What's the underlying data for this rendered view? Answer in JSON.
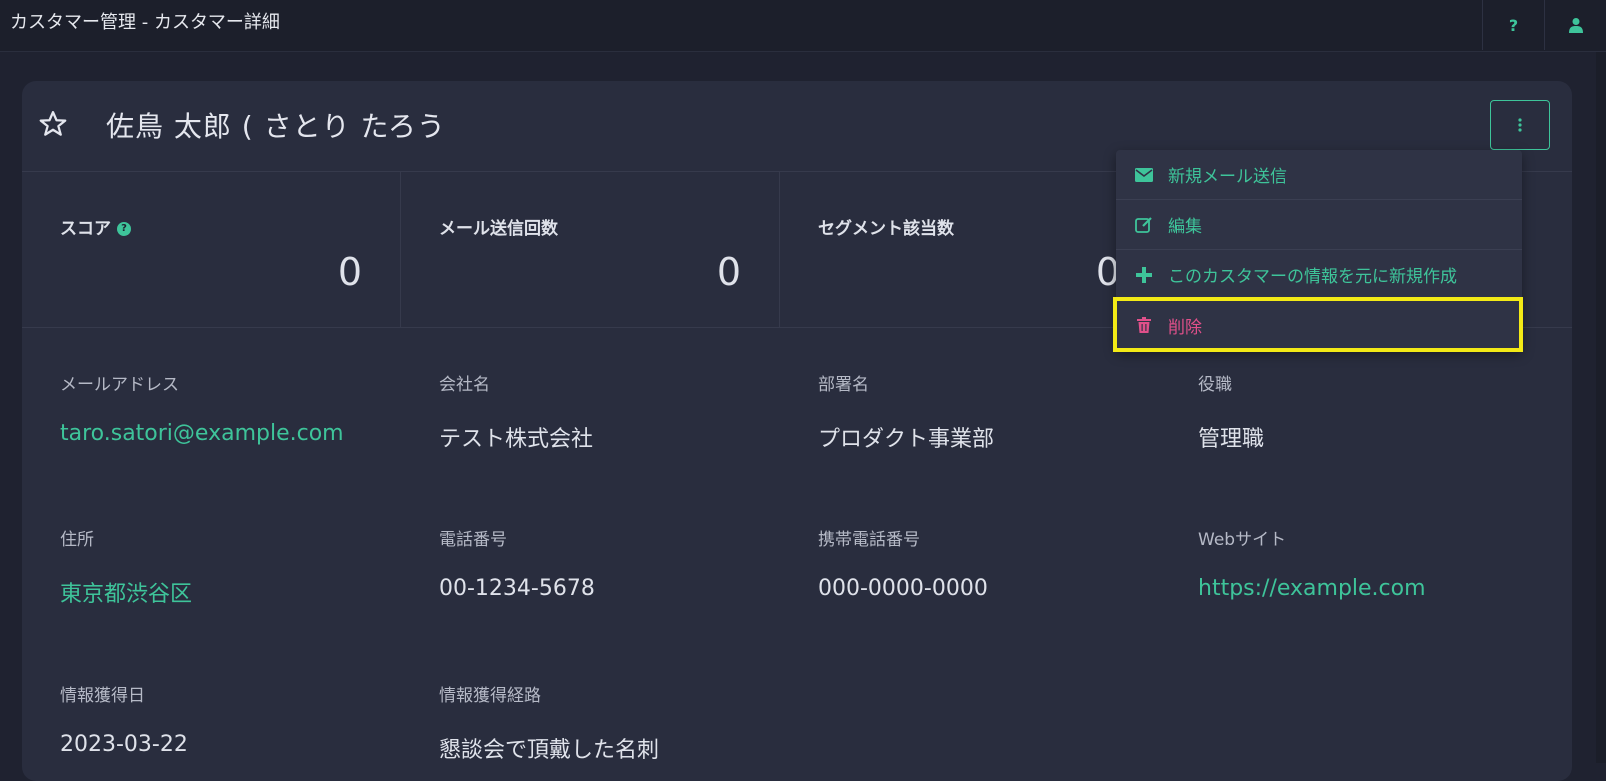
{
  "window": {
    "title": "カスタマー管理 - カスタマー詳細",
    "help_icon": "question-icon",
    "user_icon": "user-icon"
  },
  "customer": {
    "name": "佐鳥 太郎 ( さとり たろう",
    "favorite_icon": "star-outline-icon",
    "menu_icon": "kebab-vertical-icon"
  },
  "stats": [
    {
      "label": "スコア",
      "value": "0",
      "has_help": true
    },
    {
      "label": "メール送信回数",
      "value": "0",
      "has_help": false
    },
    {
      "label": "セグメント該当数",
      "value": "0",
      "has_help": false
    }
  ],
  "fields": {
    "email": {
      "label": "メールアドレス",
      "value": "taro.satori@example.com"
    },
    "company": {
      "label": "会社名",
      "value": "テスト株式会社"
    },
    "department": {
      "label": "部署名",
      "value": "プロダクト事業部"
    },
    "position": {
      "label": "役職",
      "value": "管理職"
    },
    "address": {
      "label": "住所",
      "value": "東京都渋谷区"
    },
    "phone": {
      "label": "電話番号",
      "value": "00-1234-5678"
    },
    "mobile": {
      "label": "携帯電話番号",
      "value": "000-0000-0000"
    },
    "website": {
      "label": "Webサイト",
      "value": "https://example.com"
    },
    "acquired_date": {
      "label": "情報獲得日",
      "value": "2023-03-22"
    },
    "acquired_route": {
      "label": "情報獲得経路",
      "value": "懇談会で頂戴した名刺"
    }
  },
  "dropdown": {
    "items": [
      {
        "label": "新規メール送信",
        "icon": "envelope-icon"
      },
      {
        "label": "編集",
        "icon": "edit-icon"
      },
      {
        "label": "このカスタマーの情報を元に新規作成",
        "icon": "plus-icon"
      },
      {
        "label": "削除",
        "icon": "trash-icon"
      }
    ]
  },
  "colors": {
    "accent": "#3ec49a",
    "danger": "#e0508a",
    "highlight": "#f3ea16",
    "background": "#1f2230",
    "card": "#292d3e"
  }
}
